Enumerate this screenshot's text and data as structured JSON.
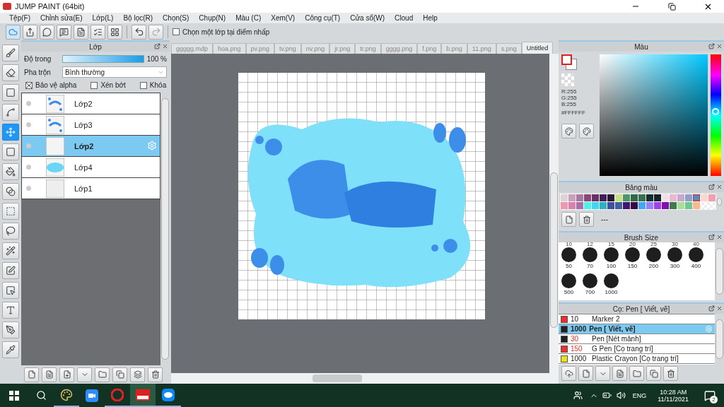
{
  "window": {
    "title": "JUMP PAINT (64bit)"
  },
  "menu": [
    "Tệp(F)",
    "Chỉnh sửa(E)",
    "Lớp(L)",
    "Bộ lọc(R)",
    "Chọn(S)",
    "Chụp(N)",
    "Màu (C)",
    "Xem(V)",
    "Công cụ(T)",
    "Cửa sổ(W)",
    "Cloud",
    "Help"
  ],
  "toolbar": {
    "pick_layer": {
      "label": "Chọn một lớp tại điểm nhấp",
      "checked": false
    }
  },
  "tools": [
    {
      "selected": false
    },
    {
      "selected": false
    },
    {
      "selected": false
    },
    {
      "selected": false
    },
    {
      "selected": true
    },
    {
      "selected": false
    },
    {
      "selected": false
    },
    {
      "selected": false
    },
    {
      "selected": false
    },
    {
      "selected": false
    },
    {
      "selected": false
    },
    {
      "selected": false
    },
    {
      "selected": false
    },
    {
      "selected": false
    },
    {
      "selected": false
    },
    {
      "selected": false
    }
  ],
  "layer_panel": {
    "title": "Lớp",
    "opacity": {
      "label": "Độ trong",
      "level": 1,
      "reading": "100 %"
    },
    "blend": {
      "label": "Pha trộn",
      "value": "Bình thường"
    },
    "options": [
      {
        "label": "Bảo vệ alpha",
        "checked": true
      },
      {
        "label": "Xén bớt",
        "checked": false
      },
      {
        "label": "Khóa",
        "checked": false
      }
    ],
    "layers": [
      {
        "name": "Lớp2",
        "selected": false
      },
      {
        "name": "Lớp3",
        "selected": false
      },
      {
        "name": "Lớp2",
        "selected": true
      },
      {
        "name": "Lớp4",
        "selected": false
      },
      {
        "name": "Lớp1",
        "selected": false
      }
    ]
  },
  "tabs": [
    {
      "label": "ggggg.mdp",
      "selected": false
    },
    {
      "label": "hoa.png",
      "selected": false
    },
    {
      "label": "pv.png",
      "selected": false
    },
    {
      "label": "tv.png",
      "selected": false
    },
    {
      "label": "nv.png",
      "selected": false
    },
    {
      "label": "jr.png",
      "selected": false
    },
    {
      "label": "tr.png",
      "selected": false
    },
    {
      "label": "gggg.png",
      "selected": false
    },
    {
      "label": "f.png",
      "selected": false
    },
    {
      "label": "b.png",
      "selected": false
    },
    {
      "label": "11.png",
      "selected": false
    },
    {
      "label": "s.png",
      "selected": false
    },
    {
      "label": "Untitled",
      "selected": true
    }
  ],
  "color_panel": {
    "title": "Màu",
    "rgb": [
      "R:255",
      "G:255",
      "B:255"
    ],
    "hex": "#FFFFFF"
  },
  "swatch_panel": {
    "title": "Bảng màu",
    "separator": "---",
    "swatches": [
      {
        "color": "#e0d0d8",
        "selected": false
      },
      {
        "color": "#c8a0b8",
        "selected": false
      },
      {
        "color": "#a878a0",
        "selected": false
      },
      {
        "color": "#884878",
        "selected": false
      },
      {
        "color": "#683068",
        "selected": false
      },
      {
        "color": "#402058",
        "selected": false
      },
      {
        "color": "#281838",
        "selected": false
      },
      {
        "color": "#c8e080",
        "selected": false
      },
      {
        "color": "#489868",
        "selected": false
      },
      {
        "color": "#306848",
        "selected": false
      },
      {
        "color": "#387050",
        "selected": false
      },
      {
        "color": "#103030",
        "selected": false
      },
      {
        "color": "#182028",
        "selected": false
      },
      {
        "color": "#f0e0e8",
        "selected": false
      },
      {
        "color": "#e8b8d0",
        "selected": false
      },
      {
        "color": "#c8a8d0",
        "selected": false
      },
      {
        "color": "#90a0c8",
        "selected": false
      },
      {
        "color": "#4890c0",
        "selected": true
      },
      {
        "color": "#f8d8d0",
        "selected": false
      },
      {
        "color": "#f0a0b0",
        "selected": false
      },
      {
        "color": "#f098b0",
        "selected": false
      },
      {
        "color": "#d880b0",
        "selected": false
      },
      {
        "color": "#a870a8",
        "selected": false
      },
      {
        "color": "#50f0e8",
        "selected": false
      },
      {
        "color": "#40d8f0",
        "selected": false
      },
      {
        "color": "#30b0c0",
        "selected": false
      },
      {
        "color": "#4050a0",
        "selected": false
      },
      {
        "color": "#4060a0",
        "selected": false
      },
      {
        "color": "#401870",
        "selected": false
      },
      {
        "color": "#380840",
        "selected": false
      },
      {
        "color": "#40a8f8",
        "selected": false
      },
      {
        "color": "#9880f8",
        "selected": false
      },
      {
        "color": "#a040f0",
        "selected": false
      },
      {
        "color": "#8010b0",
        "selected": false
      },
      {
        "color": "#407850",
        "selected": false
      },
      {
        "color": "#a8e098",
        "selected": false
      },
      {
        "color": "#70c890",
        "selected": false
      },
      {
        "color": "#f8b890",
        "selected": false
      }
    ]
  },
  "brush_size_panel": {
    "title": "Brush Size",
    "top_row": [
      "10",
      "12",
      "15",
      "20",
      "25",
      "30",
      "40"
    ],
    "sizes": [
      "50",
      "70",
      "100",
      "150",
      "200",
      "300",
      "400",
      "500",
      "700",
      "1000"
    ]
  },
  "brush_panel": {
    "title": "Cọ: Pen [ Viết, vẽ]",
    "brushes": [
      {
        "color": "#e83030",
        "size": "10",
        "name": "Marker 2",
        "size_alert": false,
        "selected": false
      },
      {
        "color": "#202020",
        "size": "1000",
        "name": "Pen [ Viết, vẽ]",
        "size_alert": false,
        "selected": true
      },
      {
        "color": "#202020",
        "size": "30",
        "name": "Pen [Nét mảnh]",
        "size_alert": true,
        "selected": false
      },
      {
        "color": "#e83030",
        "size": "150",
        "name": "G Pen [Cọ trang trí]",
        "size_alert": true,
        "selected": false
      },
      {
        "color": "#e8e020",
        "size": "1000",
        "name": "Plastic Crayon [Cọ trang trí]",
        "size_alert": false,
        "selected": false
      }
    ]
  },
  "taskbar": {
    "language": "ENG",
    "time": "10:28 AM",
    "date": "11/11/2021",
    "notifications": "2"
  }
}
